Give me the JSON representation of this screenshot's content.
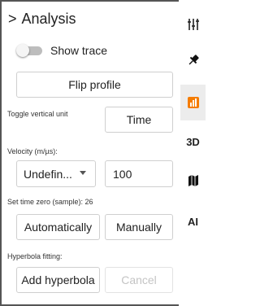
{
  "panel": {
    "title": "Analysis",
    "chevron": ">",
    "show_trace_label": "Show trace",
    "show_trace_on": false,
    "flip_profile_label": "Flip profile",
    "toggle_vertical_unit_label": "Toggle vertical unit",
    "time_button_label": "Time",
    "velocity_label": "Velocity (m/µs):",
    "velocity_select_value": "Undefin...",
    "velocity_input_value": "100",
    "set_time_zero_label": "Set time zero (sample): 26",
    "automatically_label": "Automatically",
    "manually_label": "Manually",
    "hyperbola_label": "Hyperbola fitting:",
    "add_hyperbola_label": "Add hyperbola",
    "cancel_label": "Cancel"
  },
  "tabs": [
    {
      "name": "sliders-icon",
      "label": ""
    },
    {
      "name": "pin-icon",
      "label": ""
    },
    {
      "name": "chart-icon",
      "label": "",
      "active": true,
      "color": "#f57c00"
    },
    {
      "name": "3d-tab",
      "label": "3D"
    },
    {
      "name": "map-icon",
      "label": ""
    },
    {
      "name": "ai-tab",
      "label": "AI"
    }
  ],
  "colors": {
    "accent": "#f57c00",
    "panel_border": "#555555",
    "active_tab_bg": "#ececec"
  }
}
